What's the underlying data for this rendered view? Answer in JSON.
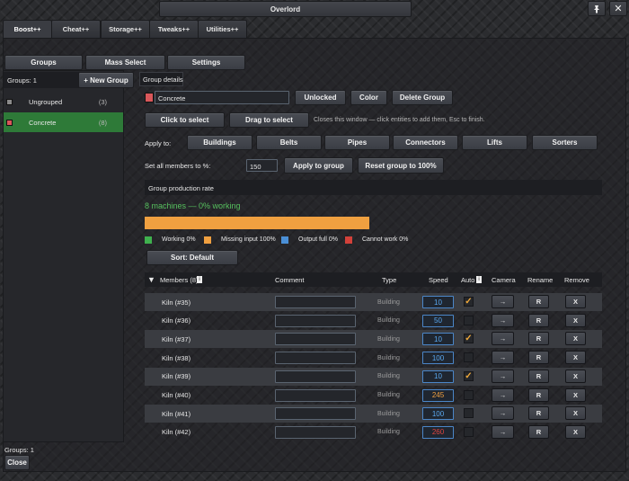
{
  "window": {
    "title": "Overlord",
    "pin_icon": "pin-icon",
    "close_icon": "close-icon"
  },
  "top_tabs": [
    "Boost++",
    "Cheat++",
    "Storage++",
    "Tweaks++",
    "Utilities++"
  ],
  "active_top_tab": "Boost++",
  "sub_tabs": [
    "Groups",
    "Mass Select",
    "Settings"
  ],
  "sidebar": {
    "groups_count_label": "Groups: 1",
    "new_group_label": "+ New Group",
    "groups": [
      {
        "name": "Ungrouped",
        "count": "(3)",
        "color": "#8a8a8a"
      },
      {
        "name": "Concrete",
        "count": "(8)",
        "color": "#d9575a",
        "selected": true
      }
    ]
  },
  "details": {
    "header": "Group details",
    "name_value": "Concrete",
    "name_color": "#d9575a",
    "unlocked_label": "Unlocked",
    "color_label": "Color",
    "delete_label": "Delete Group",
    "click_select_label": "Click to select",
    "drag_select_label": "Drag to select",
    "select_hint": "Closes this window — click entities to add them, Esc to finish.",
    "apply_to_label": "Apply to:",
    "apply_targets": [
      "Buildings",
      "Belts",
      "Pipes",
      "Connectors",
      "Lifts",
      "Sorters"
    ],
    "set_members_label": "Set all members to %:",
    "percent_value": "150",
    "apply_group_label": "Apply to group",
    "reset_group_label": "Reset group to 100%",
    "production_header": "Group production rate",
    "status_line": "8 machines — 0% working",
    "progress": {
      "missing_input_fraction": 1.0,
      "color": "#f0a040"
    },
    "legend": [
      {
        "label": "Working 0%",
        "color": "#3fb14e"
      },
      {
        "label": "Missing input 100%",
        "color": "#f0a040"
      },
      {
        "label": "Output full 0%",
        "color": "#4a8fd6"
      },
      {
        "label": "Cannot work 0%",
        "color": "#d2413a"
      }
    ],
    "sort_label": "Sort: Default"
  },
  "members_table": {
    "headers": {
      "members": "Members (8)",
      "info_badge": "i",
      "comment": "Comment",
      "type": "Type",
      "speed": "Speed",
      "auto": "Auto",
      "auto_badge": "i",
      "camera": "Camera",
      "rename": "Rename",
      "remove": "Remove"
    },
    "rows": [
      {
        "name": "Kiln (#35)",
        "type": "Building",
        "speed": "10",
        "speed_color": "#5aa8f0",
        "auto": true
      },
      {
        "name": "Kiln (#36)",
        "type": "Building",
        "speed": "50",
        "speed_color": "#5aa8f0",
        "auto": false
      },
      {
        "name": "Kiln (#37)",
        "type": "Building",
        "speed": "10",
        "speed_color": "#5aa8f0",
        "auto": true
      },
      {
        "name": "Kiln (#38)",
        "type": "Building",
        "speed": "100",
        "speed_color": "#5aa8f0",
        "auto": false
      },
      {
        "name": "Kiln (#39)",
        "type": "Building",
        "speed": "10",
        "speed_color": "#5aa8f0",
        "auto": true
      },
      {
        "name": "Kiln (#40)",
        "type": "Building",
        "speed": "245",
        "speed_color": "#f0a040",
        "auto": false
      },
      {
        "name": "Kiln (#41)",
        "type": "Building",
        "speed": "100",
        "speed_color": "#5aa8f0",
        "auto": false
      },
      {
        "name": "Kiln (#42)",
        "type": "Building",
        "speed": "260",
        "speed_color": "#e0453e",
        "auto": false
      }
    ],
    "camera_glyph": "→",
    "rename_glyph": "R",
    "remove_glyph": "X"
  },
  "footer": {
    "groups_count_label": "Groups: 1",
    "close_label": "Close"
  }
}
